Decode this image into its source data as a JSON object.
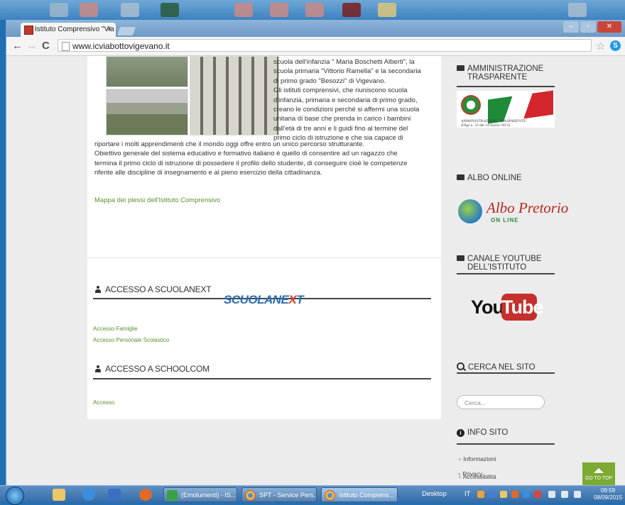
{
  "browser": {
    "tab_title": "Istituto Comprensivo \"Via",
    "tab_close": "×",
    "url": "www.icviabottovigevano.it"
  },
  "intro": {
    "right_lines": [
      "scuola  dell'infanzia \" Maria Boschetti Alberti\", la",
      "scuola primaria \"Vittorio Ramella\" e la secondaria",
      "di primo grado \"Besozzi\" di Vigevano.",
      "Gli istituti comprensivi, che riuniscono scuola",
      "d'infanzia, primaria e secondaria di primo grado,",
      "creano le condizioni perché si  affermi una  scuola",
      " unitaria  di  base  che prenda in carico i bambini",
      "dall'età di tre anni e li guidi fino al termine del",
      "primo ciclo di istruzione e che sia capace di"
    ],
    "full_lines": [
      "riportare i molti apprendimenti che il mondo oggi offre entro un unico percorso strutturante.",
      "Obiettivo generale del sistema educativo e formativo italiano  è quello di consentire ad un ragazzo  che",
      "termina il primo ciclo di istruzione di possedere  il profilo dello studente, di conseguire cioè le  competenze",
      "riferite alle discipline di insegnamento e al pieno esercizio della cittadinanza."
    ],
    "map_link": "Mappa dei plessi dell'Istituto Comprensivo"
  },
  "scuolanext": {
    "title": "ACCESSO A SCUOLANEXT",
    "logo_main": "SCUOLANE",
    "logo_x": "X",
    "logo_end": "T",
    "link_famiglie": "Accesso Famiglie",
    "link_personale": "Accesso Personale Scolastico"
  },
  "schoolcom": {
    "title": "ACCESSO A SCHOOLCOM",
    "link": "Accesso"
  },
  "sidebar": {
    "amm_title_1": "AMMINISTRAZIONE",
    "amm_title_2": "TRASPARENTE",
    "amm_logo_text": "AMMINISTRAZIONE TRASPARENTE",
    "amm_logo_sub": "(Dlgs n. 33 del 14 marzo 2013)",
    "albo_title": "ALBO ONLINE",
    "albo_logo": "Albo Pretorio",
    "albo_sub": "ON LINE",
    "yt_title_1": "CANALE YOUTUBE",
    "yt_title_2": "DELL'ISTITUTO",
    "yt_you": "You",
    "yt_tube": "Tube",
    "search_title": "CERCA NEL SITO",
    "search_placeholder": "Cerca...",
    "info_title": "INFO SITO",
    "info_links": [
      "Informazioni",
      "Accessibilità",
      "Privacy"
    ]
  },
  "gotop": "GO TO TOP",
  "taskbar": {
    "btn1": "(Emolumenti) - IS...",
    "btn2": "SPT - Service Pers...",
    "btn3": "Istituto Comprens...",
    "desktop": "Desktop",
    "lang": "IT",
    "time": "09:59",
    "date": "08/09/2015"
  },
  "colors": {
    "accent_green": "#5a8f2e",
    "gotop_green": "#7caa32",
    "youtube_red": "#c4302b",
    "scuolanext_blue": "#2a6fb4"
  }
}
